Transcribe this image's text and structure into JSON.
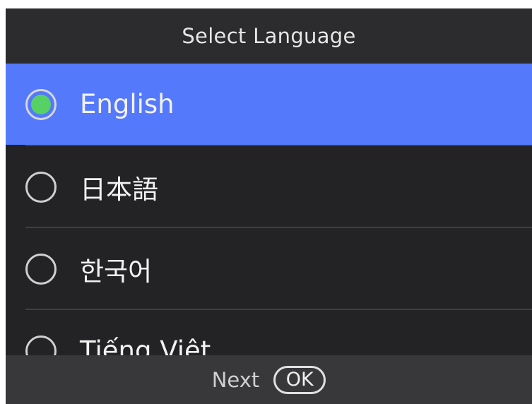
{
  "header": {
    "title": "Select Language"
  },
  "languages": [
    {
      "label": "English",
      "selected": true
    },
    {
      "label": "日本語",
      "selected": false
    },
    {
      "label": "한국어",
      "selected": false
    },
    {
      "label": "Tiếng Việt",
      "selected": false
    }
  ],
  "footer": {
    "next_label": "Next",
    "ok_label": "OK"
  },
  "colors": {
    "background": "#232326",
    "selected_row": "#5479fb",
    "radio_selected_dot": "#57d164",
    "footer": "#38383b"
  },
  "icons": {
    "radio": "radio-button-icon",
    "ok_key": "ok-key-icon"
  }
}
